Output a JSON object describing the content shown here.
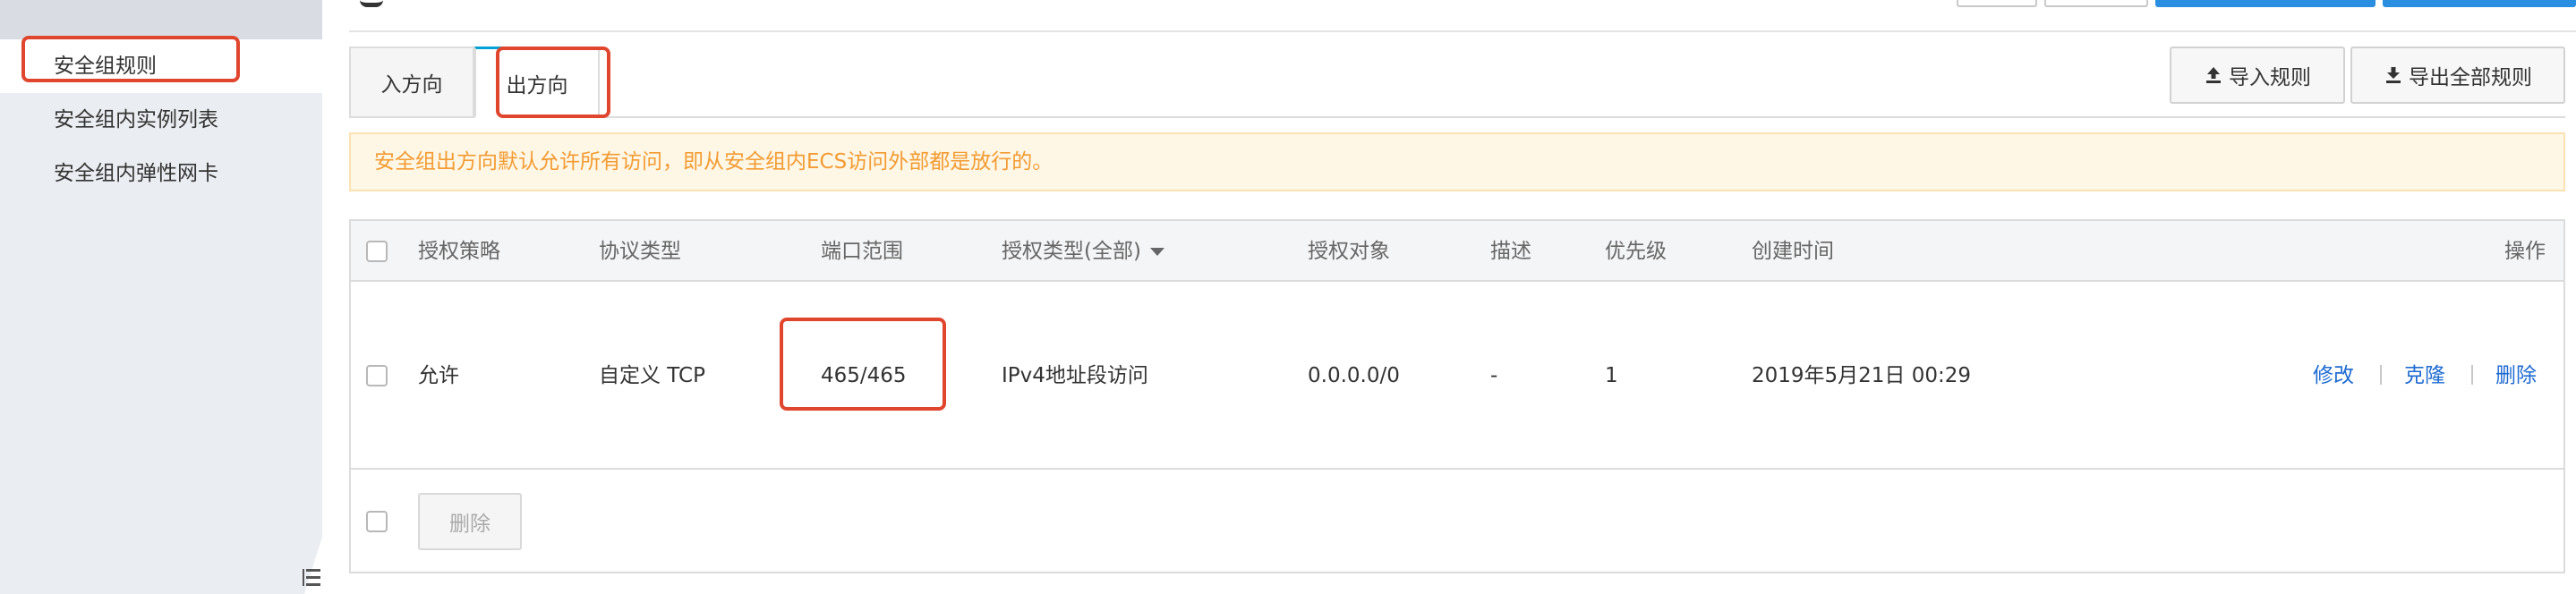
{
  "sidebar": {
    "items": [
      {
        "label": "安全组规则",
        "active": true
      },
      {
        "label": "安全组内实例列表",
        "active": false
      },
      {
        "label": "安全组内弹性网卡",
        "active": false
      }
    ]
  },
  "tabs": {
    "inbound": "入方向",
    "outbound": "出方向",
    "active": "outbound"
  },
  "toolbar": {
    "import_label": "导入规则",
    "export_label": "导出全部规则"
  },
  "notice": {
    "text": "安全组出方向默认允许所有访问，即从安全组内ECS访问外部都是放行的。",
    "color": "#f29b33"
  },
  "table": {
    "columns": {
      "policy": "授权策略",
      "protocol": "协议类型",
      "port": "端口范围",
      "auth_type": "授权类型(全部)",
      "target": "授权对象",
      "desc": "描述",
      "priority": "优先级",
      "created": "创建时间",
      "actions": "操作"
    },
    "rows": [
      {
        "policy": "允许",
        "protocol": "自定义 TCP",
        "port": "465/465",
        "auth_type": "IPv4地址段访问",
        "target": "0.0.0.0/0",
        "desc": "-",
        "priority": "1",
        "created": "2019年5月21日 00:29",
        "actions": {
          "edit": "修改",
          "clone": "克隆",
          "delete": "删除"
        }
      }
    ],
    "footer": {
      "delete_label": "删除"
    }
  },
  "colors": {
    "accent_link": "#1f6bd1",
    "highlight": "#e0462e",
    "primary_button": "#2a8fe0"
  }
}
